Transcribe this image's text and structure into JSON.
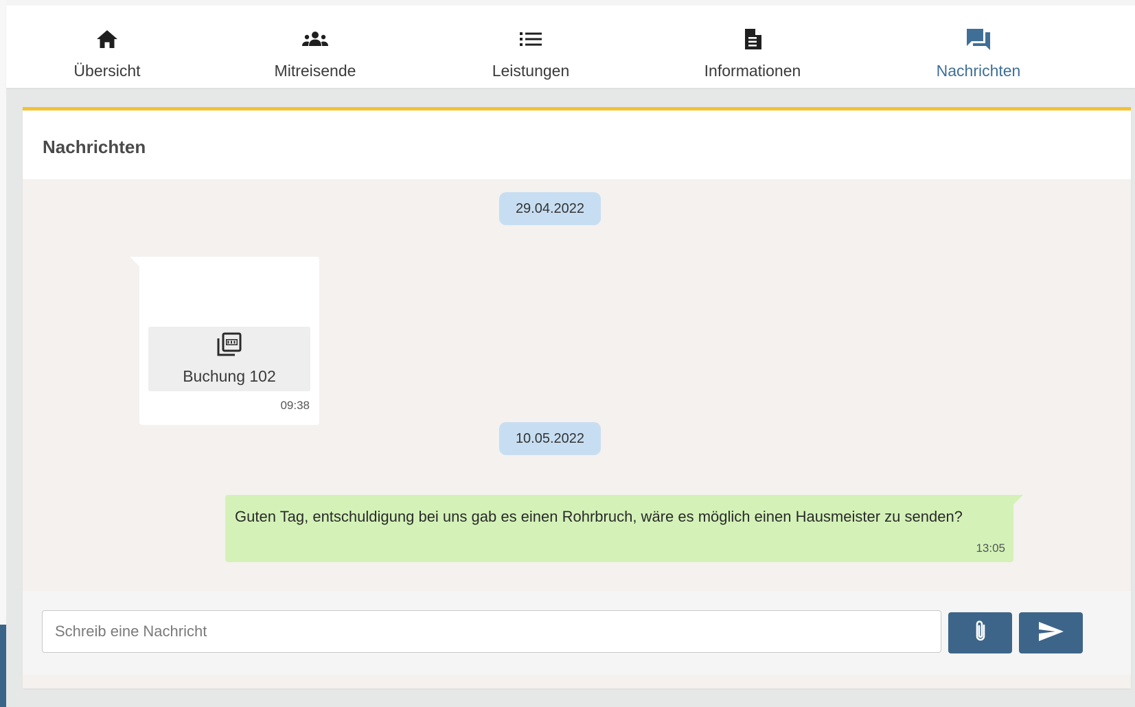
{
  "nav": {
    "items": [
      {
        "label": "Übersicht",
        "icon": "home-icon"
      },
      {
        "label": "Mitreisende",
        "icon": "people-group-icon"
      },
      {
        "label": "Leistungen",
        "icon": "list-icon"
      },
      {
        "label": "Informationen",
        "icon": "document-icon"
      },
      {
        "label": "Nachrichten",
        "icon": "chat-icon",
        "active": true
      }
    ]
  },
  "card": {
    "title": "Nachrichten"
  },
  "messages": {
    "date1": "29.04.2022",
    "incoming": {
      "attachment_name": "Buchung 102",
      "attachment_icon": "pdf-icon",
      "time": "09:38"
    },
    "date2": "10.05.2022",
    "outgoing": {
      "text": "Guten Tag, entschuldigung bei uns gab es einen Rohrbruch, wäre es möglich einen Hausmeister zu senden?",
      "time": "13:05"
    }
  },
  "composer": {
    "placeholder": "Schreib eine Nachricht",
    "value": "",
    "attach_icon": "paperclip-icon",
    "send_icon": "send-icon"
  },
  "colors": {
    "accent": "#3f6f96",
    "button": "#3d6589",
    "highlight": "#f2c232",
    "outgoing_bubble": "#d4f2b8",
    "date_chip": "#c7def2"
  }
}
